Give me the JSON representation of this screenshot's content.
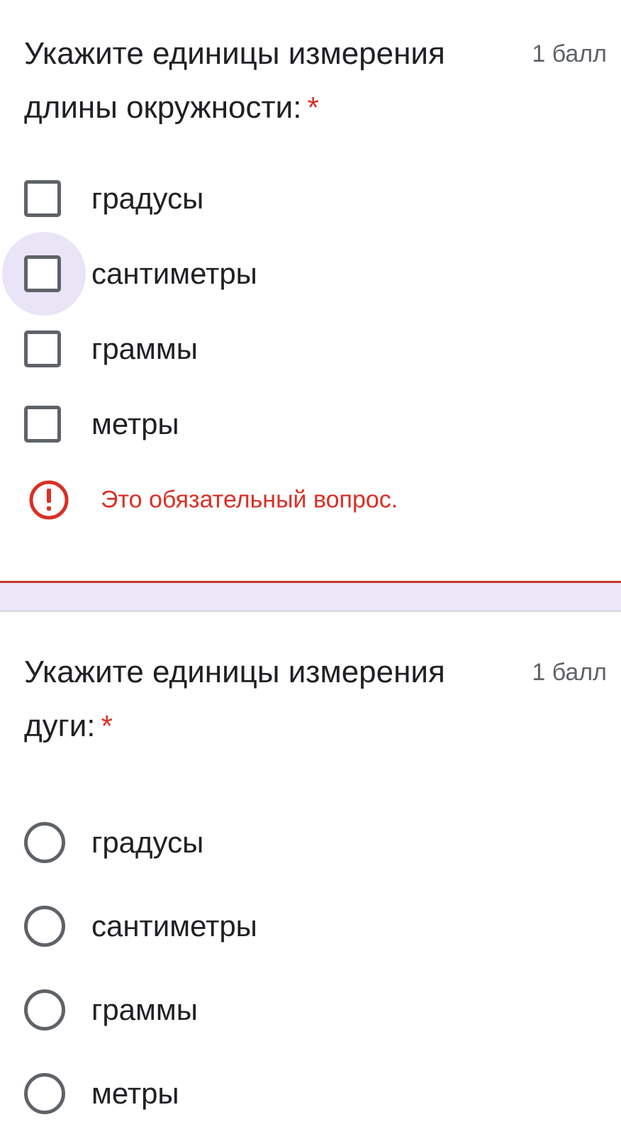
{
  "question1": {
    "title": "Укажите единицы измерения длины окружности:",
    "required_mark": "*",
    "points": "1 балл",
    "type": "checkbox",
    "options": [
      {
        "label": "градусы",
        "checked": false
      },
      {
        "label": "сантиметры",
        "checked": false,
        "focused": true
      },
      {
        "label": "граммы",
        "checked": false
      },
      {
        "label": "метры",
        "checked": false
      }
    ],
    "error": {
      "icon": "error-icon",
      "text": "Это обязательный вопрос."
    }
  },
  "question2": {
    "title": "Укажите единицы измерения дуги:",
    "required_mark": "*",
    "points": "1 балл",
    "type": "radio",
    "options": [
      {
        "label": "градусы",
        "selected": false
      },
      {
        "label": "сантиметры",
        "selected": false
      },
      {
        "label": "граммы",
        "selected": false
      },
      {
        "label": "метры",
        "selected": false
      }
    ]
  },
  "colors": {
    "text": "#202124",
    "secondary_text": "#5f6368",
    "error": "#d93025",
    "focus_halo": "#e9e4f6",
    "divider_band": "#ede8f8"
  }
}
